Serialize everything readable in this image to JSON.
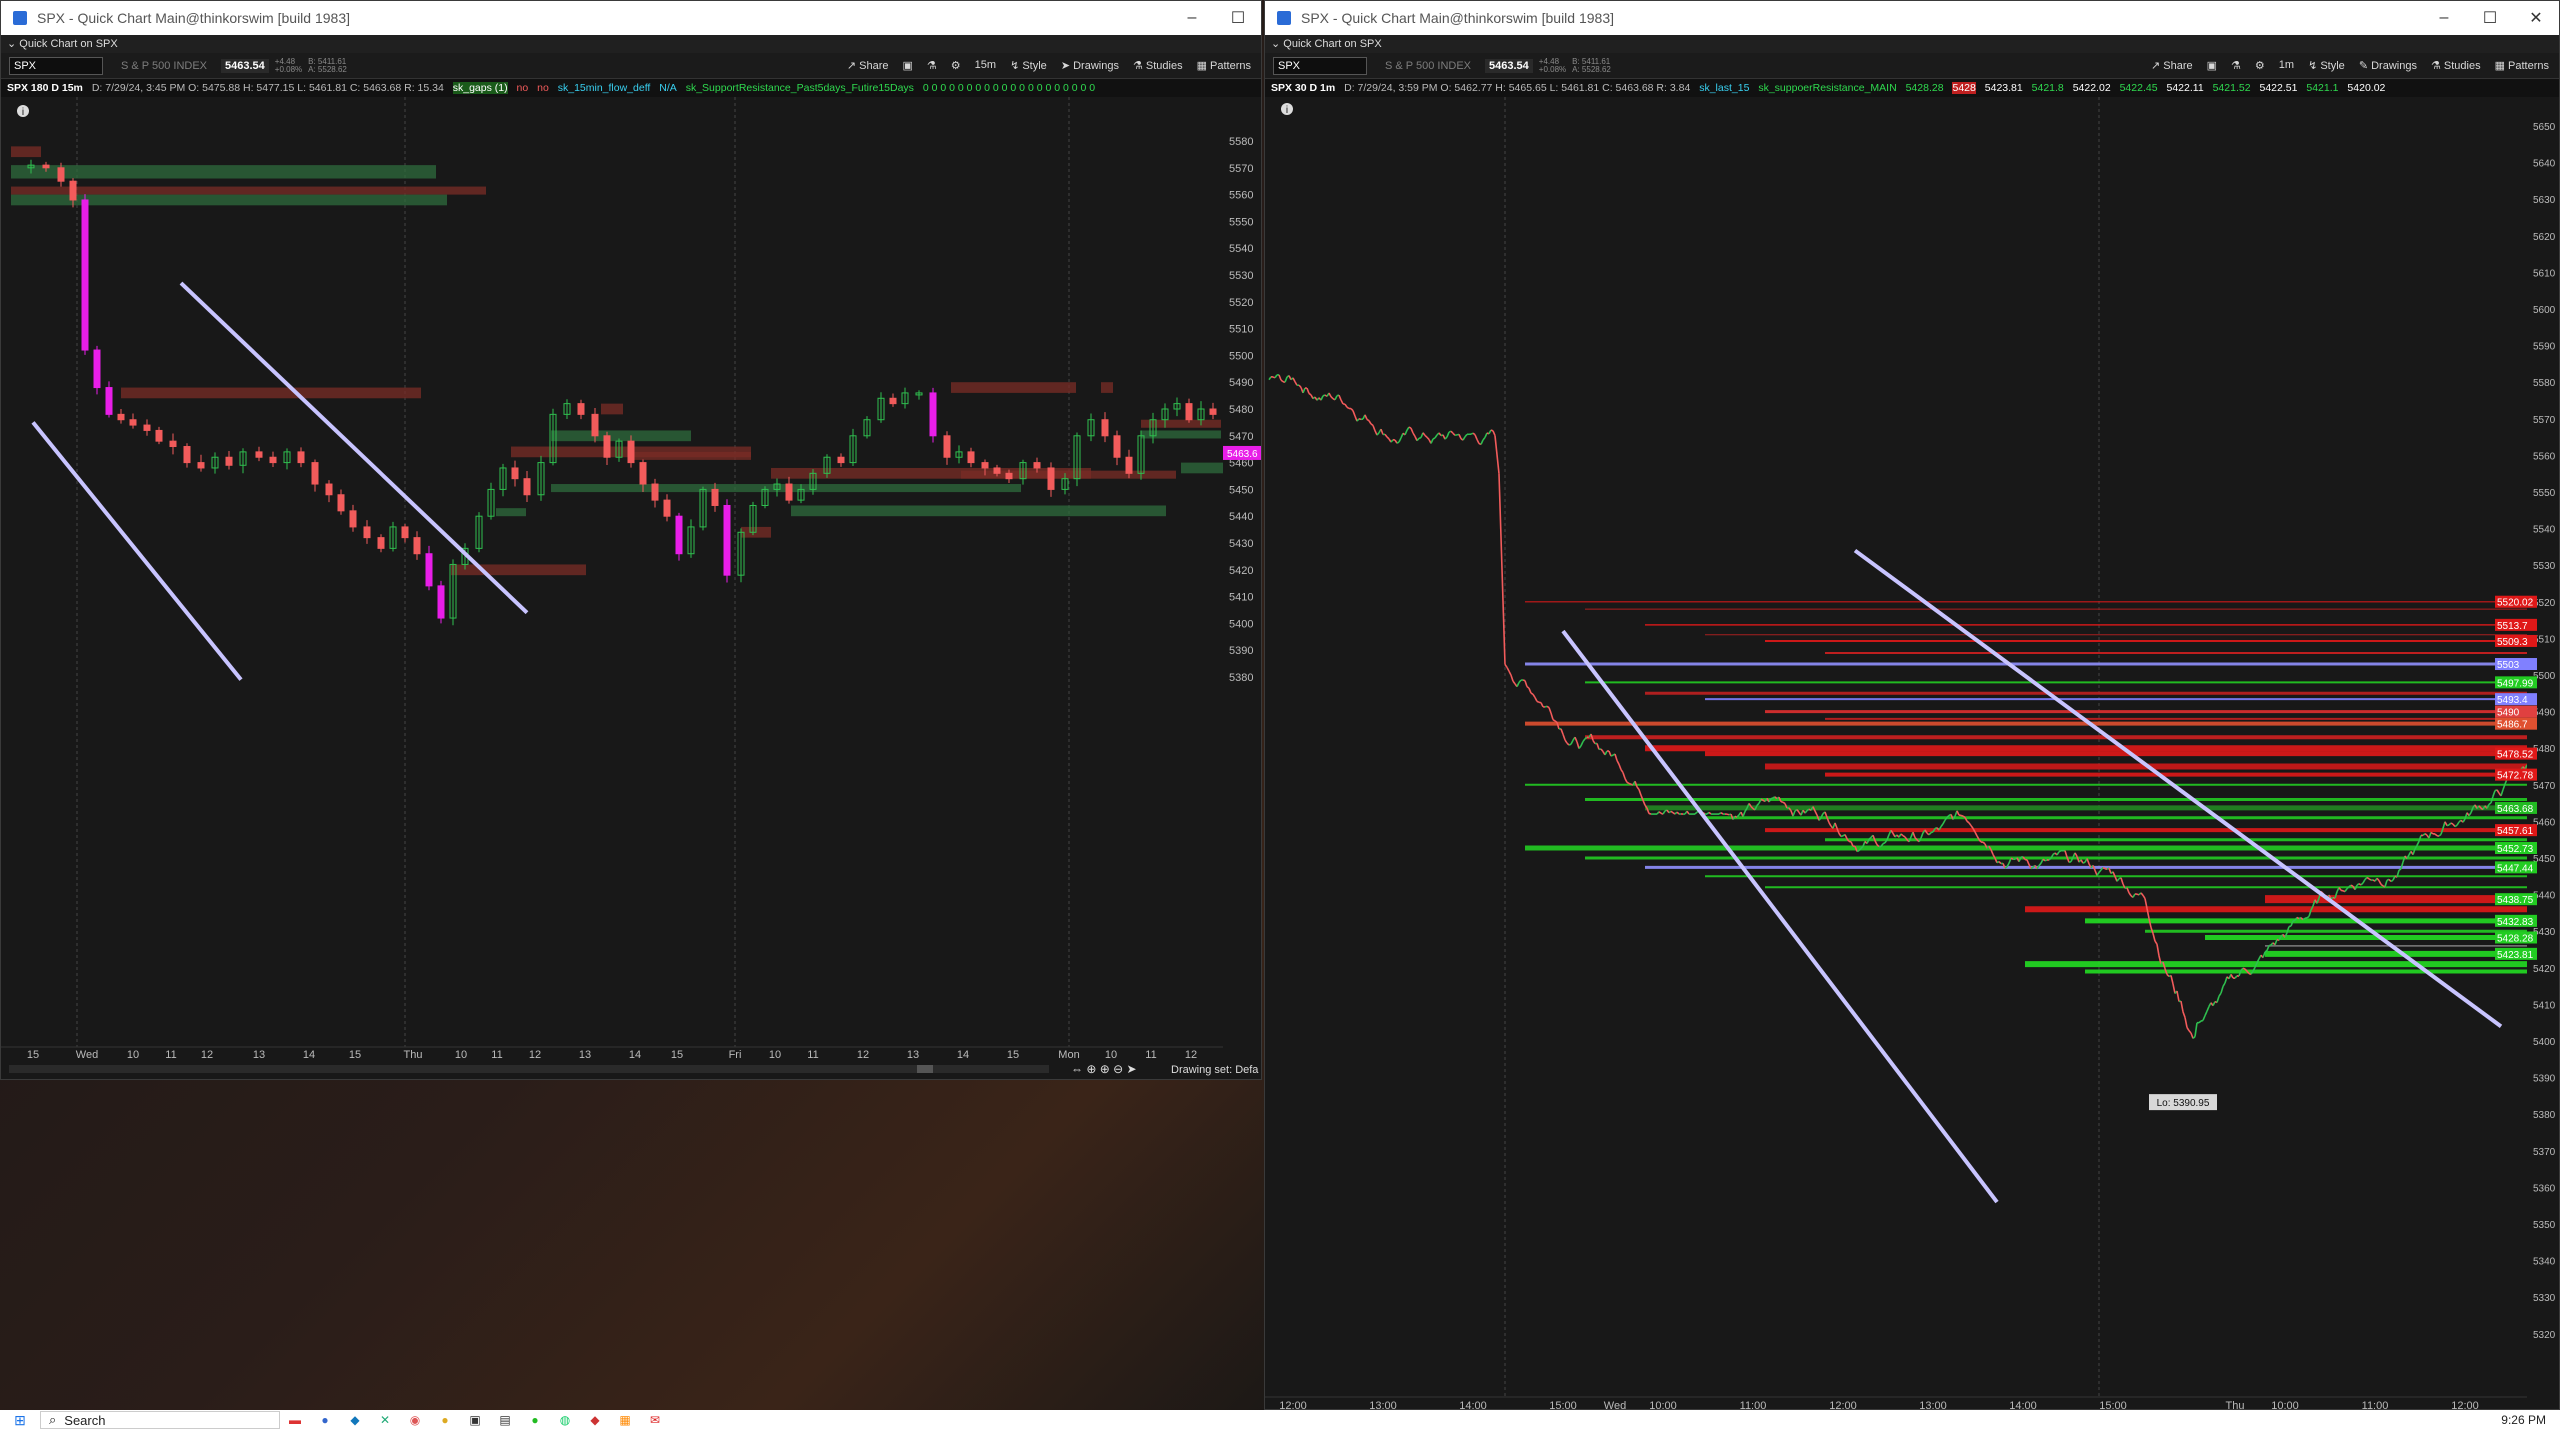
{
  "left_window": {
    "title": "SPX - Quick Chart Main@thinkorswim [build 1983]",
    "subtitle": "Quick Chart on SPX",
    "symbol": "SPX",
    "symbol_desc": "S & P 500 INDEX",
    "price": "5463.54",
    "price_change": "+4.48\n+0.08%",
    "bid_ask": "B: 5411.61\nA: 5528.62",
    "aggregation": "15m",
    "toolbar": [
      "Share",
      "Style",
      "Drawings",
      "Studies",
      "Patterns"
    ],
    "study_header": "SPX 180 D 15m",
    "ohlc": "D: 7/29/24, 3:45 PM  O: 5475.88  H: 5477.15  L: 5461.81  C: 5463.68  R: 15.34",
    "studies": [
      "sk_gaps (1)",
      "no",
      "no",
      "sk_15min_flow_deff",
      "N/A",
      "sk_SupportResistance_Past5days_Futire15Days",
      "0 0 0 0 0 0 0 0 0 0 0 0 0 0 0 0 0 0 0 0"
    ],
    "y_ticks": [
      "5580",
      "5570",
      "5560",
      "5550",
      "5540",
      "5530",
      "5520",
      "5510",
      "5500",
      "5490",
      "5480",
      "5470",
      "5460",
      "5450",
      "5440",
      "5430",
      "5420",
      "5410",
      "5400",
      "5390",
      "5380"
    ],
    "x_ticks": [
      "15",
      "Wed",
      "10",
      "11",
      "12",
      "13",
      "14",
      "15",
      "Thu",
      "10",
      "11",
      "12",
      "13",
      "14",
      "15",
      "Fri",
      "10",
      "11",
      "12",
      "13",
      "14",
      "15",
      "Mon",
      "10",
      "11",
      "12"
    ],
    "last_price_label": "5463.6",
    "drawing_set": "Drawing set: Defa"
  },
  "right_window": {
    "title": "SPX - Quick Chart Main@thinkorswim [build 1983]",
    "subtitle": "Quick Chart on SPX",
    "symbol": "SPX",
    "symbol_desc": "S & P 500 INDEX",
    "price": "5463.54",
    "price_change": "+4.48\n+0.08%",
    "bid_ask": "B: 5411.61\nA: 5528.62",
    "aggregation": "1m",
    "toolbar": [
      "Share",
      "Style",
      "Drawings",
      "Studies",
      "Patterns"
    ],
    "study_header": "SPX 30 D 1m",
    "ohlc": "D: 7/29/24, 3:59 PM  O: 5462.77  H: 5465.65  L: 5461.81  C: 5463.68  R: 3.84",
    "studies": [
      "sk_last_15",
      "sk_suppoerResistance_MAIN",
      "5428.28",
      "5428",
      "5423.81",
      "5421.8",
      "5422.02",
      "5422.45",
      "5422.11",
      "5421.52",
      "5422.51",
      "5421.1",
      "5420.02"
    ],
    "y_ticks": [
      "5650",
      "5640",
      "5630",
      "5620",
      "5610",
      "5600",
      "5590",
      "5580",
      "5570",
      "5560",
      "5550",
      "5540",
      "5530",
      "5520",
      "5510",
      "5500",
      "5490",
      "5480",
      "5470",
      "5460",
      "5450",
      "5440",
      "5430",
      "5420",
      "5410",
      "5400",
      "5390",
      "5380",
      "5370",
      "5360",
      "5350",
      "5340",
      "5330",
      "5320"
    ],
    "x_ticks": [
      "12:00",
      "13:00",
      "14:00",
      "15:00",
      "Wed",
      "10:00",
      "11:00",
      "12:00",
      "13:00",
      "14:00",
      "15:00",
      "Thu",
      "10:00",
      "11:00",
      "12:00"
    ],
    "level_labels": [
      {
        "text": "5520.02",
        "color": "#e01818"
      },
      {
        "text": "5513.7",
        "color": "#e01818"
      },
      {
        "text": "5509.3",
        "color": "#e01818"
      },
      {
        "text": "5503",
        "color": "#8080ff"
      },
      {
        "text": "5497.99",
        "color": "#22cc22"
      },
      {
        "text": "5493.4",
        "color": "#8080ff"
      },
      {
        "text": "5490",
        "color": "#e04040"
      },
      {
        "text": "5486.7",
        "color": "#e05030"
      },
      {
        "text": "5478.52",
        "color": "#e01818"
      },
      {
        "text": "5472.78",
        "color": "#e01818"
      },
      {
        "text": "5463.68",
        "color": "#22bb22"
      },
      {
        "text": "5457.61",
        "color": "#e01818"
      },
      {
        "text": "5452.73",
        "color": "#22cc22"
      },
      {
        "text": "5447.44",
        "color": "#22cc22"
      },
      {
        "text": "5438.75",
        "color": "#22cc22"
      },
      {
        "text": "5432.83",
        "color": "#22cc22"
      },
      {
        "text": "5428.28",
        "color": "#22cc22"
      },
      {
        "text": "5423.81",
        "color": "#22cc22"
      }
    ],
    "low_label": "Lo: 5390.95"
  },
  "taskbar": {
    "search": "Search",
    "clock": "9:26 PM"
  },
  "colors": {
    "up": "#2fbf4f",
    "down": "#f25b5b",
    "magenta": "#e81ee8",
    "trend": "#c8c4ff",
    "zone_green": "#2d6b3c",
    "zone_red": "#7a2c26"
  }
}
